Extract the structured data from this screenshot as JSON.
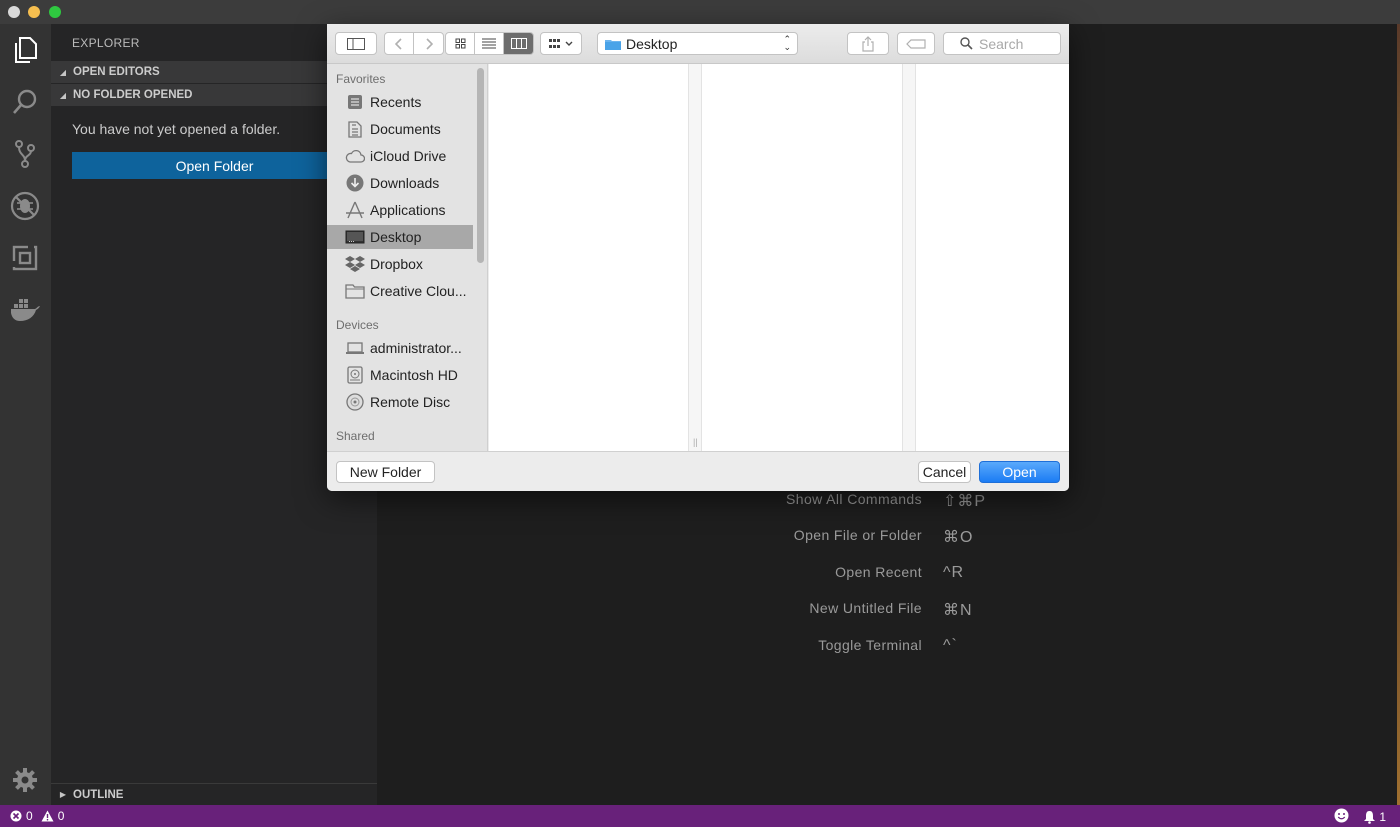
{
  "sidebar": {
    "title": "EXPLORER",
    "sections": {
      "open_editors": "OPEN EDITORS",
      "no_folder": "NO FOLDER OPENED",
      "outline": "OUTLINE"
    },
    "message": "You have not yet opened a folder.",
    "open_folder_label": "Open Folder"
  },
  "activity_icons": [
    "files-icon",
    "search-icon",
    "source-control-icon",
    "debug-icon",
    "extensions-icon",
    "docker-icon",
    "settings-gear-icon"
  ],
  "dialog": {
    "location": "Desktop",
    "search_placeholder": "Search",
    "favorites_header": "Favorites",
    "favorites": [
      {
        "label": "Recents",
        "icon": "recents-icon"
      },
      {
        "label": "Documents",
        "icon": "documents-icon"
      },
      {
        "label": "iCloud Drive",
        "icon": "cloud-icon"
      },
      {
        "label": "Downloads",
        "icon": "downloads-icon"
      },
      {
        "label": "Applications",
        "icon": "applications-icon"
      },
      {
        "label": "Desktop",
        "icon": "desktop-icon",
        "selected": true
      },
      {
        "label": "Dropbox",
        "icon": "dropbox-icon"
      },
      {
        "label": "Creative Clou...",
        "icon": "folder-icon"
      }
    ],
    "devices_header": "Devices",
    "devices": [
      {
        "label": "administrator...",
        "icon": "laptop-icon"
      },
      {
        "label": "Macintosh HD",
        "icon": "hard-drive-icon"
      },
      {
        "label": "Remote Disc",
        "icon": "disc-icon"
      }
    ],
    "shared_header": "Shared",
    "new_folder_label": "New Folder",
    "cancel_label": "Cancel",
    "open_label": "Open"
  },
  "welcome_commands": [
    {
      "label": "Show All Commands",
      "key": "⇧⌘P"
    },
    {
      "label": "Open File or Folder",
      "key": "⌘O"
    },
    {
      "label": "Open Recent",
      "key": "^R"
    },
    {
      "label": "New Untitled File",
      "key": "⌘N"
    },
    {
      "label": "Toggle Terminal",
      "key": "^`"
    }
  ],
  "statusbar": {
    "errors": "0",
    "warnings": "0",
    "notifications": "1"
  },
  "colors": {
    "statusbar": "#68217a",
    "primary_button": "#0e639c",
    "dialog_open_button": "#1b7cf4"
  }
}
